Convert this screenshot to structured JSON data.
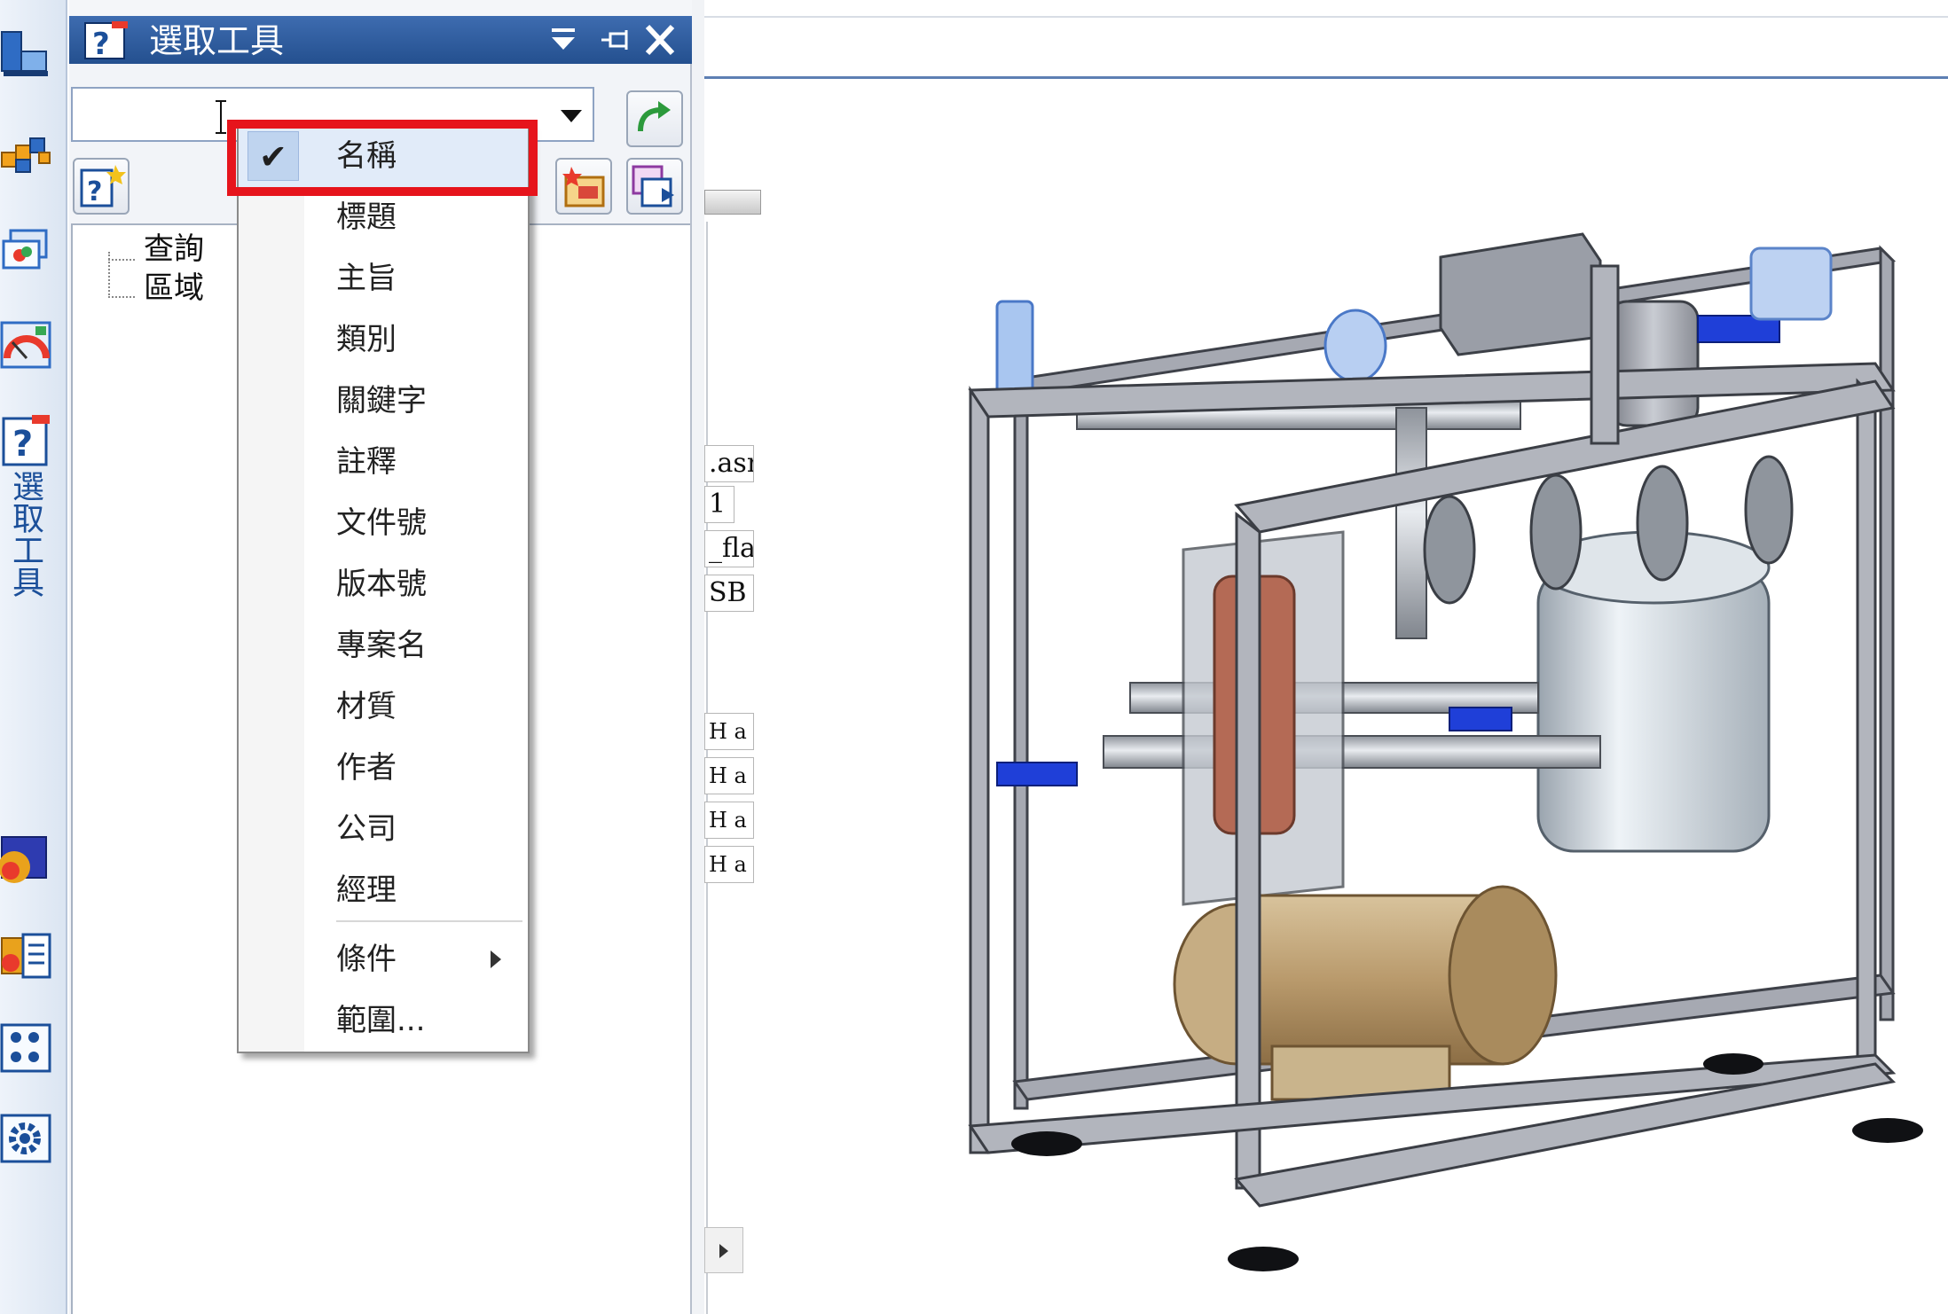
{
  "panel": {
    "title": "選取工具",
    "vertical_tab_label": "選取工具",
    "colors": {
      "title_bar": "#2d5a9c",
      "highlight": "#e6141c"
    }
  },
  "combo": {
    "value": "",
    "placeholder": ""
  },
  "tree": {
    "items": [
      "查詢",
      "區域"
    ]
  },
  "menu": {
    "items": [
      {
        "label": "名稱",
        "checked": true
      },
      {
        "label": "標題"
      },
      {
        "label": "主旨"
      },
      {
        "label": "類別"
      },
      {
        "label": "關鍵字"
      },
      {
        "label": "註釋"
      },
      {
        "label": "文件號"
      },
      {
        "label": "版本號"
      },
      {
        "label": "專案名"
      },
      {
        "label": "材質"
      },
      {
        "label": "作者"
      },
      {
        "label": "公司"
      },
      {
        "label": "經理"
      },
      {
        "label": "條件",
        "submenu": true
      },
      {
        "label": "範圍..."
      }
    ]
  },
  "background_fragments": [
    ".asn",
    "1",
    "_fla",
    "SB",
    "H a",
    "H a",
    "H a",
    "H a"
  ],
  "icons": {
    "titlebar": [
      "help-query-icon",
      "dropdown-menu-icon",
      "pin-icon",
      "close-icon"
    ],
    "sidebar": [
      "assembly-icon",
      "component-blocks-icon",
      "layers-icon",
      "gauge-icon",
      "query-tool-icon",
      "heatmap-icon",
      "properties-list-icon",
      "grid-icon",
      "settings-gear-icon"
    ],
    "toolbar": [
      "apply-arrow-icon",
      "new-query-icon",
      "highlight-icon",
      "export-icon"
    ]
  }
}
